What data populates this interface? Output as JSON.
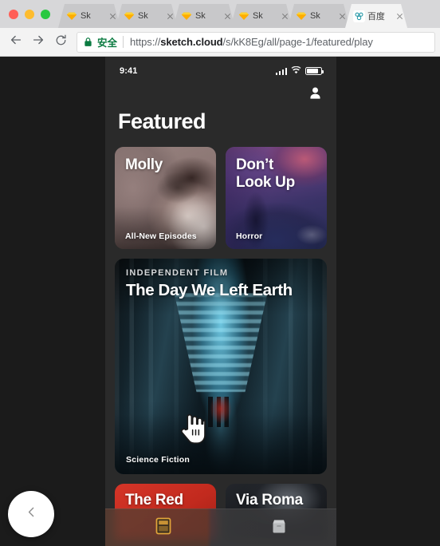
{
  "browser": {
    "traffic_lights": [
      "close",
      "minimize",
      "zoom"
    ],
    "tabs": [
      {
        "title": "Sk",
        "favicon": "sketch-icon",
        "active": false
      },
      {
        "title": "Sk",
        "favicon": "sketch-icon",
        "active": false
      },
      {
        "title": "Sk",
        "favicon": "sketch-icon",
        "active": false
      },
      {
        "title": "Sk",
        "favicon": "sketch-icon",
        "active": false
      },
      {
        "title": "Sk",
        "favicon": "sketch-icon",
        "active": false
      },
      {
        "title": "百度",
        "favicon": "baidu-icon",
        "active": true
      }
    ],
    "toolbar": {
      "back_icon": "arrow-left-icon",
      "forward_icon": "arrow-right-icon",
      "reload_icon": "reload-icon"
    },
    "omnibox": {
      "lock_icon": "lock-icon",
      "secure_label": "安全",
      "url_scheme": "https://",
      "url_host": "sketch.cloud",
      "url_path": "/s/kK8Eg/all/page-1/featured/play"
    }
  },
  "prototype": {
    "status_bar": {
      "time": "9:41",
      "signal_icon": "signal-bars-icon",
      "wifi_icon": "wifi-icon",
      "battery_icon": "battery-icon"
    },
    "nav": {
      "account_icon": "user-avatar-icon"
    },
    "page_title": "Featured",
    "cards_top": [
      {
        "title": "Molly",
        "tag": "All-New Episodes",
        "art": "molly-portrait"
      },
      {
        "title": "Don’t\nLook Up",
        "title_line1": "Don’t",
        "title_line2": "Look Up",
        "tag": "Horror",
        "art": "night-forest"
      }
    ],
    "hero_card": {
      "eyebrow": "INDEPENDENT FILM",
      "title": "The Day We Left Earth",
      "tag": "Science Fiction",
      "art": "scifi-corridor"
    },
    "cards_bottom": [
      {
        "title": "The Red",
        "art": "red-solid"
      },
      {
        "title": "Via Roma",
        "art": "dark-portrait"
      }
    ],
    "cursor_icon": "pointing-hand-cursor"
  },
  "viewer": {
    "prev_button_icon": "chevron-left-icon",
    "prev_button_label": ""
  },
  "dock": {
    "items": [
      {
        "icon": "archive-folder-icon",
        "label": ""
      },
      {
        "icon": "file-box-icon",
        "label": ""
      }
    ]
  },
  "colors": {
    "page_bg": "#1b1b1b",
    "artboard_bg": "#2a2a2a",
    "secure_green": "#0b7b41",
    "sketch_yellow": "#fdad00",
    "red_card": "#c72a1e",
    "accent_cyan": "#78d4ee"
  }
}
